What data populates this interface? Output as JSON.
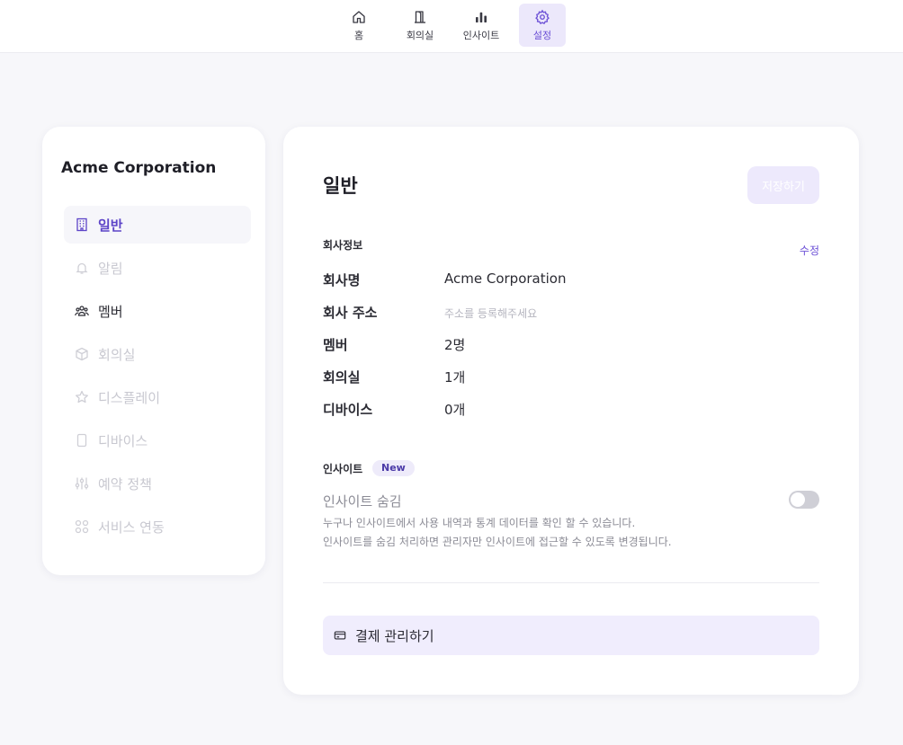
{
  "topnav": {
    "items": [
      {
        "label": "홈",
        "icon": "home-icon"
      },
      {
        "label": "회의실",
        "icon": "door-icon"
      },
      {
        "label": "인사이트",
        "icon": "bar-chart-icon"
      },
      {
        "label": "설정",
        "icon": "gear-icon",
        "active": true
      }
    ]
  },
  "sidebar": {
    "org_name": "Acme Corporation",
    "items": [
      {
        "label": "일반",
        "icon": "building-icon",
        "state": "active"
      },
      {
        "label": "알림",
        "icon": "bell-icon",
        "state": "disabled"
      },
      {
        "label": "멤버",
        "icon": "people-icon",
        "state": "enabled"
      },
      {
        "label": "회의실",
        "icon": "cube-icon",
        "state": "disabled"
      },
      {
        "label": "디스플레이",
        "icon": "star-icon",
        "state": "disabled"
      },
      {
        "label": "디바이스",
        "icon": "tablet-icon",
        "state": "disabled"
      },
      {
        "label": "예약 정책",
        "icon": "sliders-icon",
        "state": "disabled"
      },
      {
        "label": "서비스 연동",
        "icon": "grid-icon",
        "state": "disabled"
      }
    ]
  },
  "main": {
    "title": "일반",
    "save_label": "저장하기",
    "company_section": {
      "title": "회사정보",
      "edit_label": "수정",
      "rows": [
        {
          "label": "회사명",
          "value": "Acme Corporation"
        },
        {
          "label": "회사 주소",
          "value": "주소를 등록해주세요",
          "placeholder": true
        },
        {
          "label": "멤버",
          "value": "2명"
        },
        {
          "label": "회의실",
          "value": "1개"
        },
        {
          "label": "디바이스",
          "value": "0개"
        }
      ]
    },
    "insight_section": {
      "title": "인사이트",
      "badge": "New",
      "toggle_title": "인사이트 숨김",
      "toggle_on": false,
      "desc_line1": "누구나 인사이트에서 사용 내역과 통계 데이터를 확인 할 수 있습니다.",
      "desc_line2": "인사이트를 숨김 처리하면 관리자만 인사이트에 접근할 수 있도록 변경됩니다."
    },
    "billing_label": "결제 관리하기"
  },
  "colors": {
    "accent": "#6b4fd6",
    "accent_soft": "#ece8fb",
    "background": "#f7f7fa"
  }
}
